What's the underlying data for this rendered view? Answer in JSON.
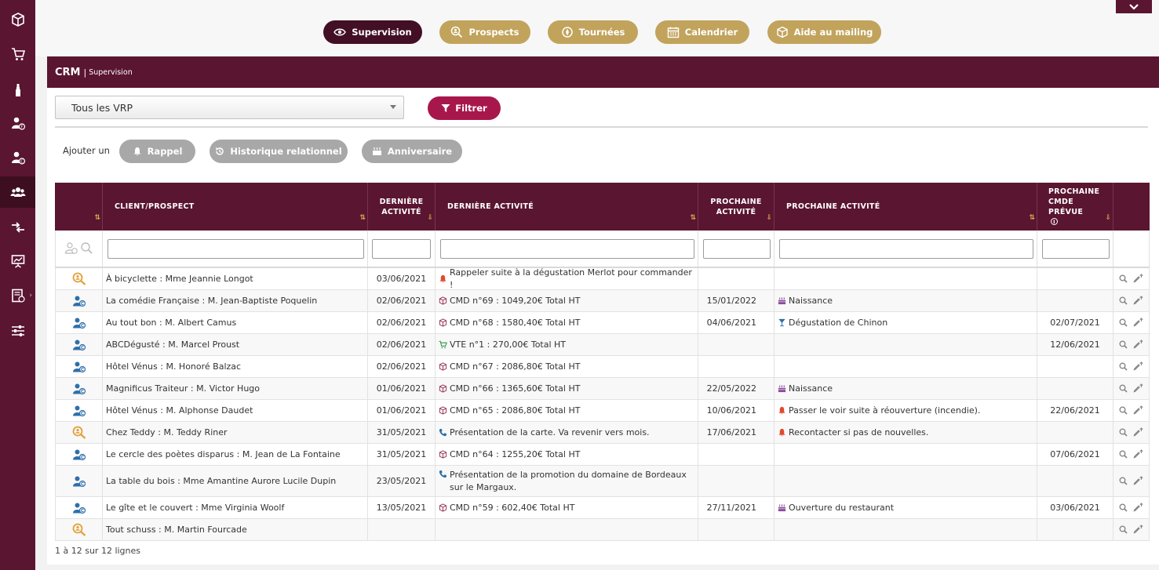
{
  "nav": {
    "items": [
      {
        "label": "Supervision",
        "icon": "eye-icon",
        "active": true
      },
      {
        "label": "Prospects",
        "icon": "search-person-icon",
        "active": false
      },
      {
        "label": "Tournées",
        "icon": "route-icon",
        "active": false
      },
      {
        "label": "Calendrier",
        "icon": "calendar-icon",
        "active": false
      },
      {
        "label": "Aide au mailing",
        "icon": "mailing-icon",
        "active": false
      }
    ]
  },
  "sidebar": {
    "items": [
      {
        "icon": "box-icon"
      },
      {
        "icon": "cart-icon"
      },
      {
        "icon": "bottle-icon"
      },
      {
        "icon": "supplier-icon"
      },
      {
        "icon": "client-icon"
      },
      {
        "icon": "users-icon",
        "active": true
      },
      {
        "icon": "transfer-icon"
      },
      {
        "icon": "presentation-icon"
      },
      {
        "icon": "invoice-icon"
      },
      {
        "icon": "settings-sliders-icon"
      }
    ]
  },
  "header": {
    "title": "CRM",
    "separator": "|",
    "subtitle": "Supervision"
  },
  "filter": {
    "vrp_value": "Tous les VRP",
    "button_label": "Filtrer"
  },
  "add": {
    "label": "Ajouter un",
    "buttons": [
      "Rappel",
      "Historique relationnel",
      "Anniversaire"
    ]
  },
  "table": {
    "columns": [
      {
        "label": ""
      },
      {
        "label": "CLIENT/PROSPECT"
      },
      {
        "label": "DERNIÈRE ACTIVITÉ"
      },
      {
        "label": "DERNIÈRE ACTIVITÉ"
      },
      {
        "label": "PROCHAINE ACTIVITÉ"
      },
      {
        "label": "PROCHAINE ACTIVITÉ"
      },
      {
        "label": "PROCHAINE CMDE PRÉVUE"
      },
      {
        "label": ""
      }
    ],
    "rows": [
      {
        "type": "prospect",
        "client": "À bicyclette : Mme Jeannie Longot",
        "last_date": "03/06/2021",
        "last_icon": "bell",
        "last_activity": "Rappeler suite à la dégustation Merlot pour commander !",
        "next_date": "",
        "next_icon": "",
        "next_activity": "",
        "next_order": ""
      },
      {
        "type": "client",
        "client": "La comédie Française : M. Jean-Baptiste Poquelin",
        "last_date": "02/06/2021",
        "last_icon": "box",
        "last_activity": "CMD n°69 : 1049,20€ Total HT",
        "next_date": "15/01/2022",
        "next_icon": "cake",
        "next_activity": "Naissance",
        "next_order": ""
      },
      {
        "type": "client",
        "client": "Au tout bon : M. Albert Camus",
        "last_date": "02/06/2021",
        "last_icon": "box",
        "last_activity": "CMD n°68 : 1580,40€ Total HT",
        "next_date": "04/06/2021",
        "next_icon": "glass",
        "next_activity": "Dégustation de Chinon",
        "next_order": "02/07/2021"
      },
      {
        "type": "client",
        "client": "ABCDégusté : M. Marcel Proust",
        "last_date": "02/06/2021",
        "last_icon": "cart",
        "last_activity": "VTE n°1 : 270,00€ Total HT",
        "next_date": "",
        "next_icon": "",
        "next_activity": "",
        "next_order": "12/06/2021"
      },
      {
        "type": "client",
        "client": "Hôtel Vénus : M. Honoré Balzac",
        "last_date": "02/06/2021",
        "last_icon": "box",
        "last_activity": "CMD n°67 : 2086,80€ Total HT",
        "next_date": "",
        "next_icon": "",
        "next_activity": "",
        "next_order": ""
      },
      {
        "type": "client",
        "client": "Magnificus Traiteur : M. Victor Hugo",
        "last_date": "01/06/2021",
        "last_icon": "box",
        "last_activity": "CMD n°66 : 1365,60€ Total HT",
        "next_date": "22/05/2022",
        "next_icon": "cake",
        "next_activity": "Naissance",
        "next_order": ""
      },
      {
        "type": "client",
        "client": "Hôtel Vénus : M. Alphonse Daudet",
        "last_date": "01/06/2021",
        "last_icon": "box",
        "last_activity": "CMD n°65 : 2086,80€ Total HT",
        "next_date": "10/06/2021",
        "next_icon": "bell",
        "next_activity": "Passer le voir suite à réouverture (incendie).",
        "next_order": "22/06/2021"
      },
      {
        "type": "prospect",
        "client": "Chez Teddy : M. Teddy Riner",
        "last_date": "31/05/2021",
        "last_icon": "phone",
        "last_activity": "Présentation de la carte. Va revenir vers mois.",
        "next_date": "17/06/2021",
        "next_icon": "bell",
        "next_activity": "Recontacter si pas de nouvelles.",
        "next_order": ""
      },
      {
        "type": "client",
        "client": "Le cercle des poètes disparus : M. Jean de La Fontaine",
        "last_date": "31/05/2021",
        "last_icon": "box",
        "last_activity": "CMD n°64 : 1255,20€ Total HT",
        "next_date": "",
        "next_icon": "",
        "next_activity": "",
        "next_order": "07/06/2021"
      },
      {
        "type": "client",
        "client": "La table du bois : Mme Amantine Aurore Lucile Dupin",
        "last_date": "23/05/2021",
        "last_icon": "phone",
        "last_activity": "Présentation de la promotion du domaine de Bordeaux sur le Margaux.",
        "next_date": "",
        "next_icon": "",
        "next_activity": "",
        "next_order": ""
      },
      {
        "type": "client",
        "client": "Le gîte et le couvert : Mme Virginia Woolf",
        "last_date": "13/05/2021",
        "last_icon": "box",
        "last_activity": "CMD n°59 : 602,40€ Total HT",
        "next_date": "27/11/2021",
        "next_icon": "cake",
        "next_activity": "Ouverture du restaurant",
        "next_order": "03/06/2021"
      },
      {
        "type": "prospect",
        "client": "Tout schuss : M. Martin Fourcade",
        "last_date": "",
        "last_icon": "",
        "last_activity": "",
        "next_date": "",
        "next_icon": "",
        "next_activity": "",
        "next_order": ""
      }
    ]
  },
  "footer": {
    "pagination": "1 à 12 sur 12 lignes"
  },
  "colors": {
    "primary": "#5a1530",
    "gold": "#c1a35c",
    "filter": "#a8174b",
    "gray_button": "#a8a8a8"
  }
}
